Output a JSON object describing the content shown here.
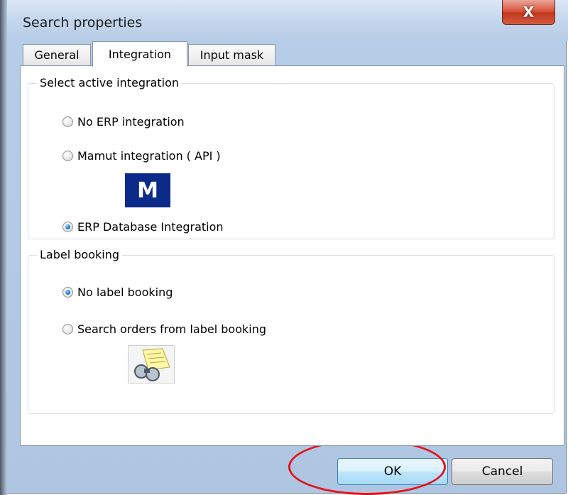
{
  "window": {
    "title": "Search properties",
    "close_glyph": "X"
  },
  "tabs": [
    {
      "label": "General",
      "active": false
    },
    {
      "label": "Integration",
      "active": true
    },
    {
      "label": "Input mask",
      "active": false
    }
  ],
  "integration_group": {
    "title": "Select active integration",
    "options": [
      {
        "label": "No ERP integration",
        "checked": false
      },
      {
        "label": "Mamut integration ( API )",
        "checked": false
      },
      {
        "label": "ERP Database Integration",
        "checked": true
      }
    ],
    "logo_text": "M"
  },
  "label_group": {
    "title": "Label booking",
    "options": [
      {
        "label": "No label booking",
        "checked": true
      },
      {
        "label": "Search orders from label booking",
        "checked": false
      }
    ]
  },
  "buttons": {
    "ok": "OK",
    "cancel": "Cancel"
  },
  "colors": {
    "annotation": "#e3141e",
    "radio_selected": "#2a7fd0",
    "mamut_logo": "#0c2a8a"
  },
  "icons": {
    "radio": "radio-icon",
    "mamut": "mamut-logo-icon",
    "label_booking": "label-booking-icon"
  }
}
